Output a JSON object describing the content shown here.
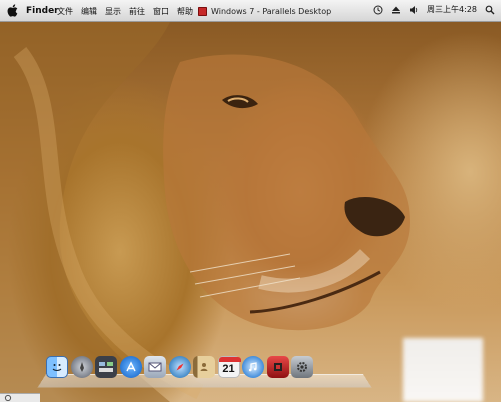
{
  "menubar": {
    "app_name": "Finder",
    "menus": [
      "文件",
      "编辑",
      "显示",
      "前往",
      "窗口",
      "帮助"
    ],
    "window_title": "Windows 7 - Parallels Desktop",
    "clock": "周三上午4:28",
    "icons": [
      "apple-icon",
      "time-machine-icon",
      "eject-icon",
      "volume-icon",
      "spotlight-icon"
    ]
  },
  "desktop": {
    "wallpaper": "lion-wallpaper"
  },
  "dock": {
    "items": [
      {
        "name": "finder",
        "color": "#5aa0e8"
      },
      {
        "name": "launchpad",
        "color": "#7a7f8a"
      },
      {
        "name": "mission-control",
        "color": "#3b3f48"
      },
      {
        "name": "app-store",
        "color": "#2f86e8"
      },
      {
        "name": "mail",
        "color": "#9aa7b8"
      },
      {
        "name": "safari",
        "color": "#3a84c4"
      },
      {
        "name": "contacts",
        "color": "#c5a26a"
      },
      {
        "name": "calendar",
        "color": "#f4f4f4",
        "label": "21"
      },
      {
        "name": "itunes",
        "color": "#2c7fd6"
      },
      {
        "name": "photo-booth",
        "color": "#c0282b"
      },
      {
        "name": "system-preferences",
        "color": "#8f959c"
      }
    ]
  }
}
